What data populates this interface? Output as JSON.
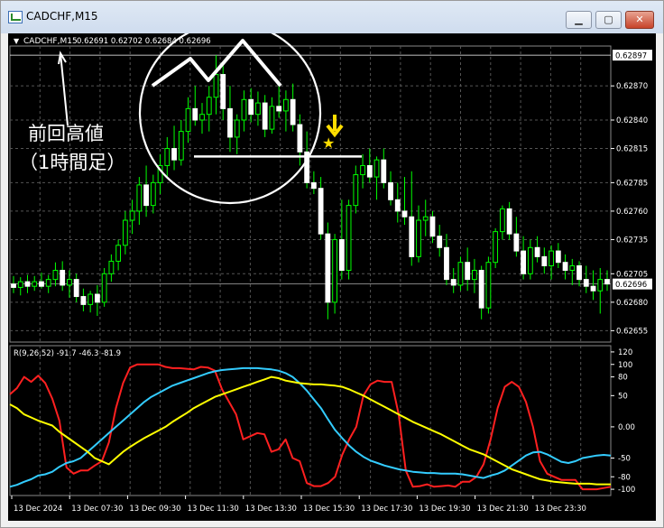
{
  "window": {
    "title": "CADCHF,M15",
    "buttons": {
      "minimize": "▁",
      "maximize": "▢",
      "close": "✕"
    }
  },
  "chart_data": [
    {
      "type": "candlestick",
      "header": {
        "arrow": "▼",
        "symbol": "CADCHF,M15",
        "ohlc": "0.62691 0.62702 0.62684 0.62696"
      },
      "price_axis": {
        "ticks": [
          "0.62870",
          "0.62840",
          "0.62815",
          "0.62785",
          "0.62760",
          "0.62735",
          "0.62705",
          "0.62680",
          "0.62655"
        ],
        "ylim": [
          0.62645,
          0.62905
        ],
        "high_label": "0.62897",
        "current_price": 0.62696,
        "current_label": "0.62696"
      },
      "candles": [
        [
          0.62696,
          0.62703,
          0.62688,
          0.62693
        ],
        [
          0.62693,
          0.62702,
          0.62686,
          0.62698
        ],
        [
          0.62698,
          0.62704,
          0.62688,
          0.62694
        ],
        [
          0.62694,
          0.62703,
          0.6269,
          0.62698
        ],
        [
          0.62698,
          0.62706,
          0.62692,
          0.62694
        ],
        [
          0.62694,
          0.62704,
          0.62688,
          0.627
        ],
        [
          0.627,
          0.62715,
          0.62694,
          0.62708
        ],
        [
          0.62708,
          0.62716,
          0.6269,
          0.62695
        ],
        [
          0.62695,
          0.62708,
          0.62684,
          0.627
        ],
        [
          0.627,
          0.62705,
          0.6268,
          0.62685
        ],
        [
          0.62685,
          0.62692,
          0.62672,
          0.62678
        ],
        [
          0.62678,
          0.6269,
          0.62671,
          0.62687
        ],
        [
          0.62687,
          0.62695,
          0.62668,
          0.6268
        ],
        [
          0.6268,
          0.6271,
          0.62676,
          0.62705
        ],
        [
          0.62705,
          0.62722,
          0.62698,
          0.62716
        ],
        [
          0.62716,
          0.62735,
          0.62708,
          0.6273
        ],
        [
          0.6273,
          0.6276,
          0.62722,
          0.62752
        ],
        [
          0.62752,
          0.6277,
          0.6274,
          0.6276
        ],
        [
          0.6276,
          0.6279,
          0.62748,
          0.62783
        ],
        [
          0.62783,
          0.628,
          0.62755,
          0.62765
        ],
        [
          0.62765,
          0.62792,
          0.62758,
          0.62785
        ],
        [
          0.62785,
          0.6281,
          0.62775,
          0.628
        ],
        [
          0.628,
          0.62825,
          0.6279,
          0.62815
        ],
        [
          0.62815,
          0.62835,
          0.62796,
          0.62805
        ],
        [
          0.62805,
          0.6284,
          0.628,
          0.6283
        ],
        [
          0.6283,
          0.6286,
          0.6282,
          0.6285
        ],
        [
          0.6285,
          0.6287,
          0.62835,
          0.6284
        ],
        [
          0.6284,
          0.62855,
          0.62828,
          0.62845
        ],
        [
          0.62845,
          0.6287,
          0.6283,
          0.6286
        ],
        [
          0.6286,
          0.62897,
          0.62845,
          0.6288
        ],
        [
          0.6288,
          0.6289,
          0.6284,
          0.6285
        ],
        [
          0.6285,
          0.6287,
          0.62812,
          0.62825
        ],
        [
          0.62825,
          0.62845,
          0.6281,
          0.6284
        ],
        [
          0.6284,
          0.62866,
          0.6283,
          0.62858
        ],
        [
          0.62858,
          0.62868,
          0.62838,
          0.62845
        ],
        [
          0.62845,
          0.62865,
          0.62835,
          0.62855
        ],
        [
          0.62855,
          0.62862,
          0.62825,
          0.62832
        ],
        [
          0.62832,
          0.6286,
          0.62828,
          0.62852
        ],
        [
          0.62852,
          0.6287,
          0.62842,
          0.62848
        ],
        [
          0.62848,
          0.62866,
          0.6283,
          0.62858
        ],
        [
          0.62858,
          0.62872,
          0.6283,
          0.62836
        ],
        [
          0.62836,
          0.62845,
          0.628,
          0.62812
        ],
        [
          0.62812,
          0.6283,
          0.6278,
          0.62785
        ],
        [
          0.62785,
          0.62795,
          0.62775,
          0.6278
        ],
        [
          0.6278,
          0.6279,
          0.62735,
          0.6274
        ],
        [
          0.6274,
          0.6275,
          0.62665,
          0.6268
        ],
        [
          0.6268,
          0.6274,
          0.6267,
          0.62735
        ],
        [
          0.62735,
          0.6277,
          0.627,
          0.62708
        ],
        [
          0.62708,
          0.6277,
          0.627,
          0.62765
        ],
        [
          0.62765,
          0.628,
          0.62758,
          0.62792
        ],
        [
          0.62792,
          0.6281,
          0.6278,
          0.628
        ],
        [
          0.628,
          0.62815,
          0.62785,
          0.6279
        ],
        [
          0.6279,
          0.62808,
          0.6277,
          0.62805
        ],
        [
          0.62805,
          0.62815,
          0.6278,
          0.62785
        ],
        [
          0.62785,
          0.62795,
          0.62765,
          0.6277
        ],
        [
          0.6277,
          0.62785,
          0.6275,
          0.6276
        ],
        [
          0.6276,
          0.6279,
          0.62748,
          0.62755
        ],
        [
          0.62755,
          0.62795,
          0.62712,
          0.6272
        ],
        [
          0.6272,
          0.62765,
          0.62715,
          0.62752
        ],
        [
          0.62752,
          0.6277,
          0.62738,
          0.62755
        ],
        [
          0.62755,
          0.6276,
          0.62732,
          0.62738
        ],
        [
          0.62738,
          0.62748,
          0.6272,
          0.62728
        ],
        [
          0.62728,
          0.6274,
          0.62695,
          0.627
        ],
        [
          0.627,
          0.6271,
          0.62688,
          0.62695
        ],
        [
          0.62695,
          0.6272,
          0.6269,
          0.62715
        ],
        [
          0.62715,
          0.62728,
          0.6269,
          0.627
        ],
        [
          0.627,
          0.62718,
          0.62688,
          0.62708
        ],
        [
          0.62708,
          0.62712,
          0.62665,
          0.62675
        ],
        [
          0.62675,
          0.6272,
          0.6267,
          0.62715
        ],
        [
          0.62715,
          0.62745,
          0.6271,
          0.62742
        ],
        [
          0.62742,
          0.62765,
          0.62735,
          0.62762
        ],
        [
          0.62762,
          0.62768,
          0.62735,
          0.6274
        ],
        [
          0.6274,
          0.62755,
          0.6272,
          0.62725
        ],
        [
          0.62725,
          0.62738,
          0.627,
          0.62705
        ],
        [
          0.62705,
          0.62735,
          0.627,
          0.62728
        ],
        [
          0.62728,
          0.62738,
          0.62715,
          0.6272
        ],
        [
          0.6272,
          0.62728,
          0.62705,
          0.62712
        ],
        [
          0.62712,
          0.6273,
          0.627,
          0.62725
        ],
        [
          0.62725,
          0.62732,
          0.6271,
          0.62715
        ],
        [
          0.62715,
          0.62722,
          0.627,
          0.62708
        ],
        [
          0.62708,
          0.62718,
          0.62695,
          0.62712
        ],
        [
          0.62712,
          0.62716,
          0.62694,
          0.627
        ],
        [
          0.627,
          0.62712,
          0.62688,
          0.62694
        ],
        [
          0.62694,
          0.62708,
          0.62682,
          0.6269
        ],
        [
          0.6269,
          0.6271,
          0.6267,
          0.627
        ],
        [
          0.627,
          0.62708,
          0.6269,
          0.62696
        ]
      ],
      "annotations": {
        "label_line1": "前回高値",
        "label_line2": "（1時間足）",
        "previous_high_level": 0.62808,
        "colors": {
          "annotation": "#ffffff",
          "arrow": "#ffdd00",
          "star": "#ffdd00"
        }
      },
      "colors": {
        "bull": "#00ff00",
        "bear": "#ffffff",
        "wick": "#00ff00",
        "grid": "#555555",
        "axis_text": "#ffffff"
      }
    },
    {
      "type": "line",
      "indicator_label": "R(9,26,52) -91.7 -46.3 -81.9",
      "axis_ticks": [
        "120",
        "100",
        "80",
        "50",
        "0.00",
        "-50",
        "-80",
        "-100"
      ],
      "ylim": [
        -110,
        130
      ],
      "series": [
        {
          "color": "#ff2020",
          "values": [
            52,
            62,
            80,
            72,
            82,
            70,
            45,
            10,
            -65,
            -75,
            -70,
            -70,
            -62,
            -55,
            -25,
            30,
            70,
            95,
            100,
            100,
            100,
            100,
            96,
            94,
            94,
            93,
            92,
            96,
            95,
            90,
            60,
            40,
            20,
            -20,
            -15,
            -10,
            -12,
            -40,
            -36,
            -20,
            -50,
            -55,
            -90,
            -95,
            -95,
            -90,
            -80,
            -45,
            -20,
            0,
            50,
            68,
            74,
            72,
            72,
            20,
            -70,
            -96,
            -95,
            -92,
            -96,
            -95,
            -94,
            -96,
            -88,
            -88,
            -80,
            -60,
            -20,
            30,
            64,
            72,
            64,
            40,
            0,
            -55,
            -75,
            -80,
            -85,
            -85,
            -85,
            -100,
            -100,
            -100,
            -98,
            -96
          ]
        },
        {
          "color": "#33ccff",
          "values": [
            -96,
            -93,
            -88,
            -84,
            -78,
            -76,
            -72,
            -64,
            -58,
            -55,
            -50,
            -40,
            -30,
            -20,
            -10,
            0,
            10,
            20,
            30,
            40,
            48,
            54,
            60,
            66,
            70,
            74,
            78,
            82,
            86,
            89,
            91,
            92,
            93,
            94,
            94,
            94,
            93,
            92,
            90,
            86,
            80,
            70,
            58,
            44,
            30,
            12,
            -5,
            -18,
            -30,
            -40,
            -48,
            -54,
            -58,
            -62,
            -65,
            -68,
            -70,
            -72,
            -73,
            -74,
            -74,
            -75,
            -75,
            -75,
            -76,
            -78,
            -80,
            -82,
            -78,
            -75,
            -70,
            -62,
            -54,
            -46,
            -41,
            -40,
            -44,
            -50,
            -56,
            -58,
            -55,
            -50,
            -48,
            -46,
            -45,
            -46
          ]
        },
        {
          "color": "#ffff00",
          "values": [
            36,
            30,
            20,
            15,
            10,
            6,
            2,
            -8,
            -16,
            -24,
            -32,
            -40,
            -50,
            -55,
            -60,
            -50,
            -40,
            -32,
            -25,
            -18,
            -12,
            -6,
            0,
            8,
            15,
            22,
            30,
            36,
            42,
            48,
            52,
            56,
            60,
            64,
            68,
            72,
            76,
            80,
            78,
            74,
            72,
            70,
            69,
            68,
            68,
            67,
            66,
            64,
            60,
            55,
            50,
            44,
            38,
            32,
            26,
            20,
            14,
            8,
            3,
            -2,
            -7,
            -12,
            -18,
            -24,
            -30,
            -36,
            -40,
            -44,
            -50,
            -56,
            -62,
            -68,
            -72,
            -76,
            -80,
            -84,
            -86,
            -88,
            -89,
            -90,
            -91,
            -91,
            -91,
            -92,
            -92,
            -92
          ]
        }
      ]
    }
  ],
  "time_axis": {
    "labels": [
      "13 Dec 2024",
      "13 Dec 07:30",
      "13 Dec 09:30",
      "13 Dec 11:30",
      "13 Dec 13:30",
      "13 Dec 15:30",
      "13 Dec 17:30",
      "13 Dec 19:30",
      "13 Dec 21:30",
      "13 Dec 23:30"
    ]
  }
}
